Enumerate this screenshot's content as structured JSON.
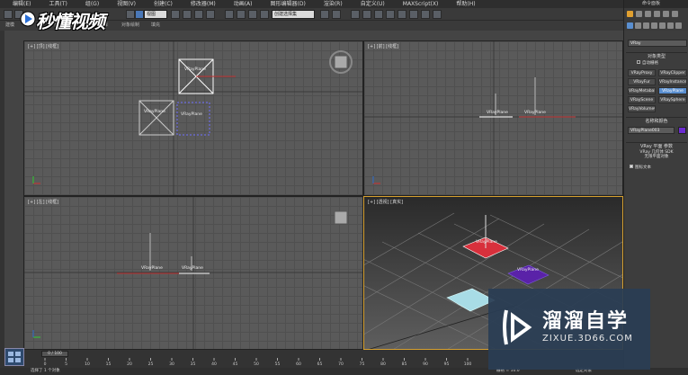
{
  "menubar": {
    "items": [
      "编辑(E)",
      "工具(T)",
      "组(G)",
      "视图(V)",
      "创建(C)",
      "修改器(M)",
      "动画(A)",
      "图形编辑器(D)",
      "渲染(R)",
      "自定义(U)",
      "MAXScript(X)",
      "帮助(H)"
    ]
  },
  "toolbar": {
    "view_dropdown": "视图",
    "selection_set": "创建选择集"
  },
  "ribbon": {
    "labels": [
      "建模",
      "自由形式",
      "选择",
      "对象绘制",
      "填充"
    ]
  },
  "viewports": {
    "top": {
      "label": "[+] [顶] [线框]"
    },
    "front": {
      "label": "[+] [前] [线框]"
    },
    "left": {
      "label": "[+] [左] [线框]"
    },
    "persp": {
      "label": "[+] [透视] [真实]"
    },
    "object_labels": {
      "top_plane_1": "VRayPlane",
      "top_plane_2": "VRayPlane",
      "top_plane_3": "VRayPlane",
      "front_plane_1": "VRayPlane",
      "front_plane_2": "VRayPlane",
      "left_plane_1": "VRayPlane",
      "left_plane_2": "VRayPlane",
      "persp_plane_1": "VRayPlane",
      "persp_plane_2": "VRayPlane"
    }
  },
  "command_panel": {
    "header": "命令面板",
    "renderer_dropdown": "VRay",
    "object_type_title": "对象类型",
    "autogrid_label": "自动栅格",
    "buttons": [
      "VRayProxy",
      "VRayClipper",
      "VRayFur",
      "VRayInstancer",
      "VRayMetaball",
      "VRayPlane",
      "VRayScene",
      "VRaySphere",
      "VRayVolumeGrid"
    ],
    "active_button": "VRayPlane",
    "name_color_title": "名称和颜色",
    "name_value": "VRayPlane003",
    "params_title": "VRay 平面 参数",
    "params_lines": [
      "VRay 几何体 SDK",
      "无限平面对象"
    ],
    "checkbox_label": "图标文本"
  },
  "timeline": {
    "frame_indicator": "0 / 100",
    "ticks": [
      "0",
      "5",
      "10",
      "15",
      "20",
      "25",
      "30",
      "35",
      "40",
      "45",
      "50",
      "55",
      "60",
      "65",
      "70",
      "75",
      "80",
      "85",
      "90",
      "95",
      "100"
    ]
  },
  "status": {
    "selection_text": "选择了 1 个对象",
    "grid_text": "栅格 = 10.0",
    "key_mode": "选定对象"
  },
  "watermarks": {
    "top_left": "秒懂视频",
    "bottom_right_title": "溜溜自学",
    "bottom_right_url": "ZIXUE.3D66.COM"
  }
}
